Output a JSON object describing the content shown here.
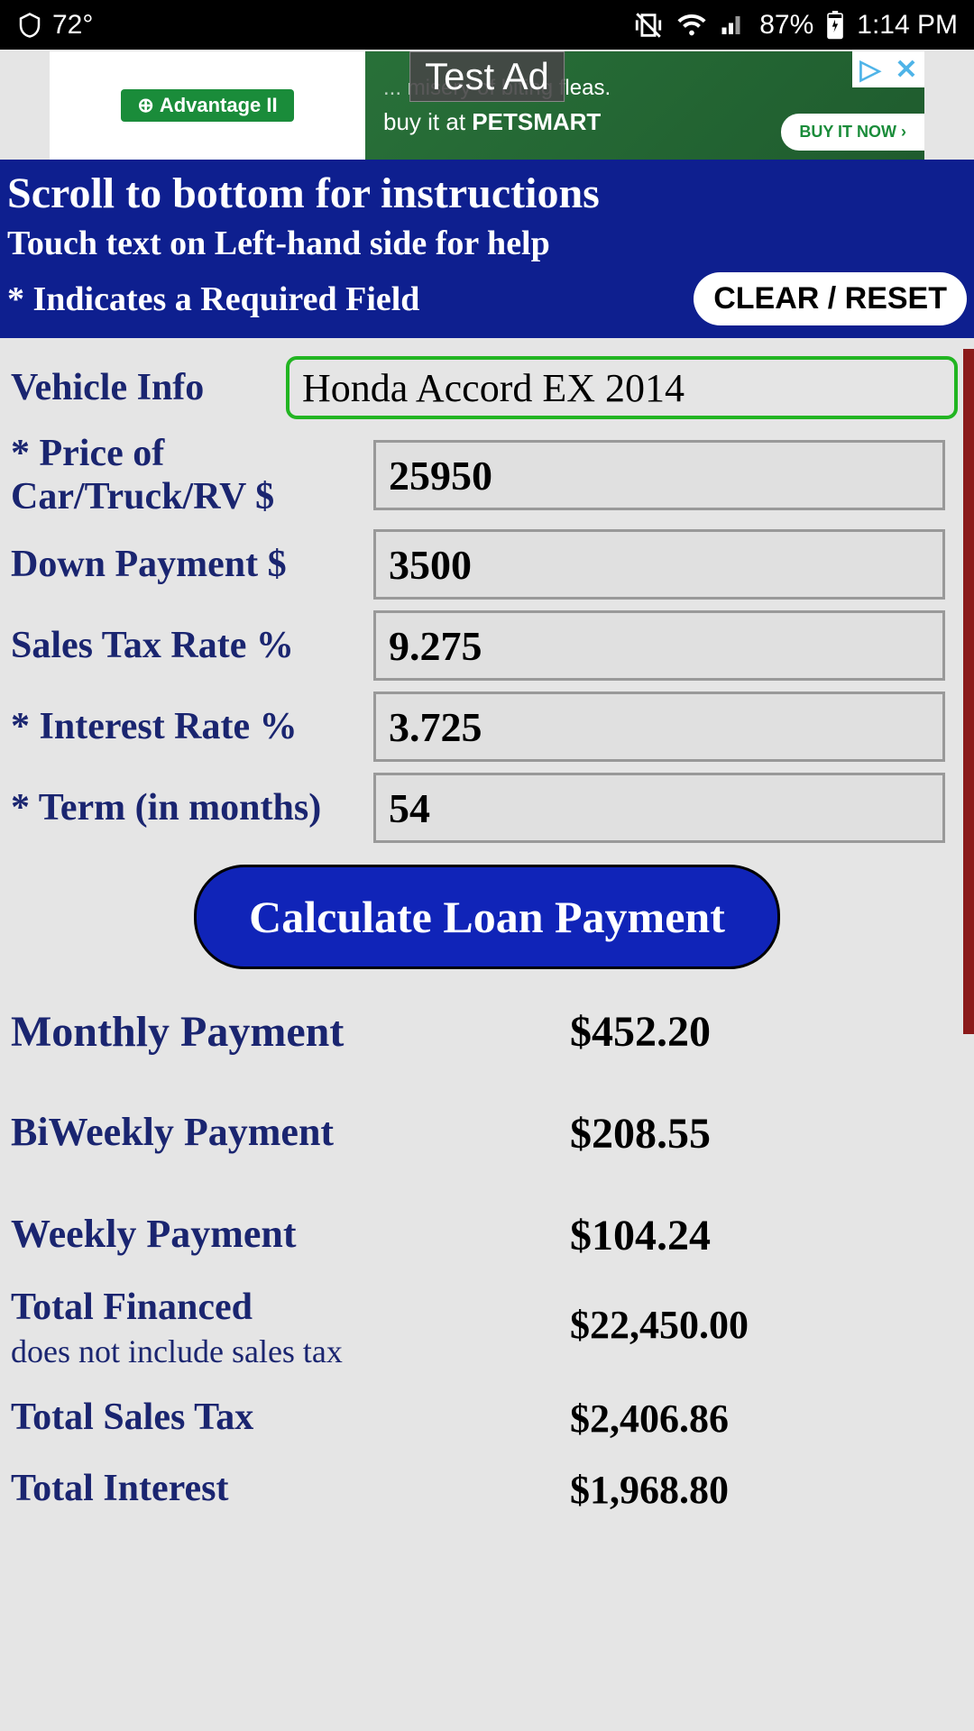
{
  "status": {
    "temp": "72°",
    "battery": "87%",
    "time": "1:14 PM"
  },
  "ad": {
    "label": "Test Ad",
    "brand": "Advantage II",
    "tagline_top": "misery of biting fleas.",
    "tagline_bottom_prefix": "buy it at",
    "store": "PETSMART",
    "cta": "BUY IT NOW ›"
  },
  "instructions": {
    "line1": "Scroll to bottom for instructions",
    "line2": "Touch text on Left-hand side for help",
    "line3": "* Indicates a Required Field",
    "clear_btn": "CLEAR / RESET"
  },
  "form": {
    "vehicle_label": "Vehicle Info",
    "vehicle_value": "Honda Accord EX 2014",
    "price_label": "* Price of Car/Truck/RV $",
    "price_value": "25950",
    "down_label": "Down Payment $",
    "down_value": "3500",
    "tax_label": "Sales Tax Rate %",
    "tax_value": "9.275",
    "interest_label": "* Interest Rate %",
    "interest_value": "3.725",
    "term_label": "* Term (in months)",
    "term_value": "54",
    "calculate_btn": "Calculate Loan Payment"
  },
  "results": {
    "monthly_label": "Monthly Payment",
    "monthly_value": "$452.20",
    "biweekly_label": "BiWeekly Payment",
    "biweekly_value": "$208.55",
    "weekly_label": "Weekly Payment",
    "weekly_value": "$104.24",
    "financed_label": "Total Financed",
    "financed_sub": "does not include sales tax",
    "financed_value": "$22,450.00",
    "salestax_label": "Total Sales Tax",
    "salestax_value": "$2,406.86",
    "interest_label": "Total Interest",
    "interest_value": "$1,968.80"
  }
}
